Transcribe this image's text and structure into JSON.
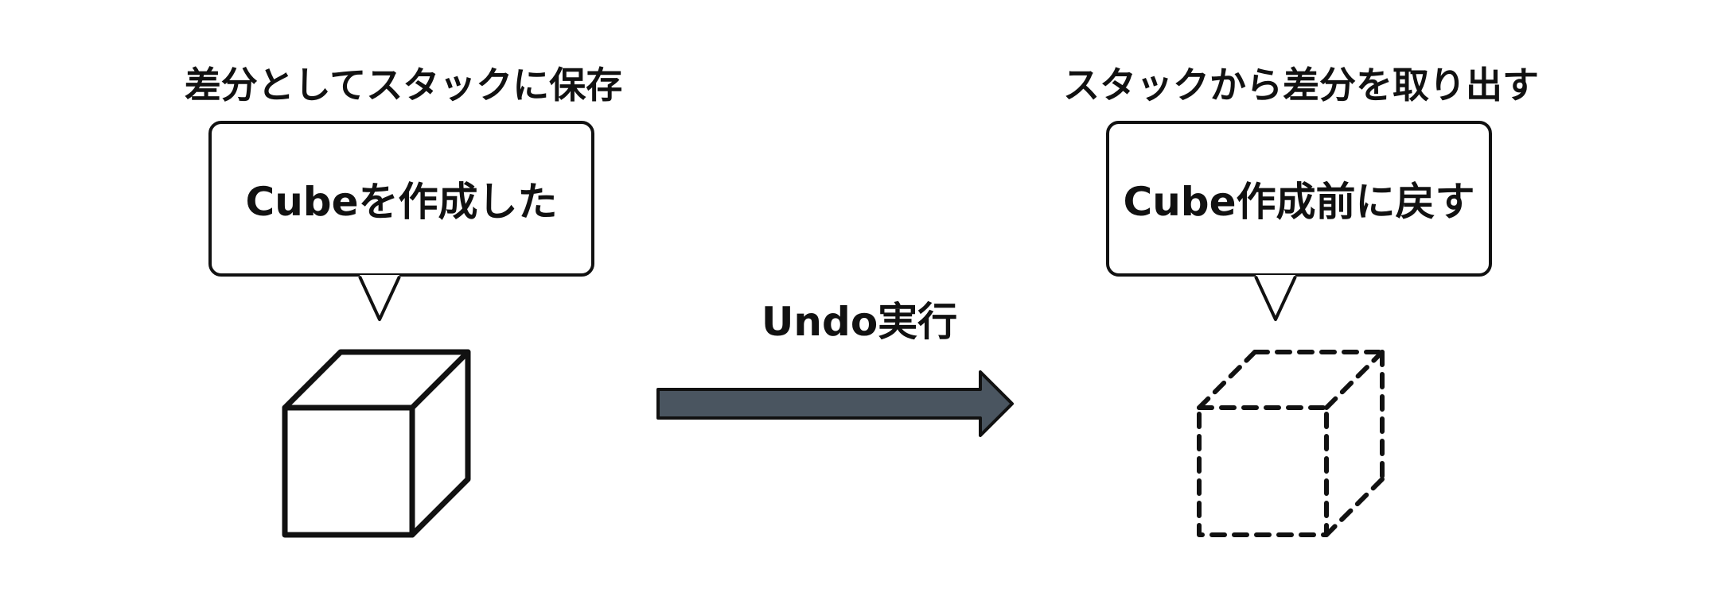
{
  "left": {
    "heading": "差分としてスタックに保存",
    "bubble_text": "Cubeを作成した"
  },
  "center": {
    "label": "Undo実行"
  },
  "right": {
    "heading": "スタックから差分を取り出す",
    "bubble_text": "Cube作成前に戻す"
  },
  "colors": {
    "stroke": "#111111",
    "arrow_fill": "#4a5560"
  }
}
